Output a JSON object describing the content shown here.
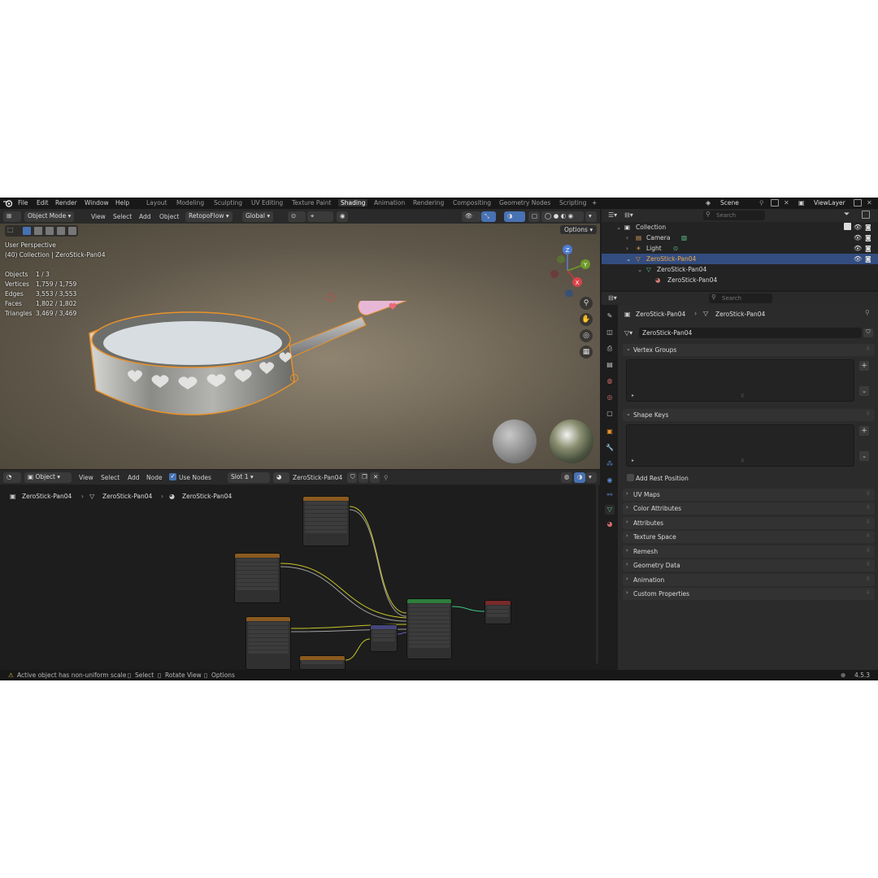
{
  "menu": {
    "file": "File",
    "edit": "Edit",
    "render": "Render",
    "window": "Window",
    "help": "Help"
  },
  "workspaces": [
    "Layout",
    "Modeling",
    "Sculpting",
    "UV Editing",
    "Texture Paint",
    "Shading",
    "Animation",
    "Rendering",
    "Compositing",
    "Geometry Nodes",
    "Scripting"
  ],
  "active_workspace": "Shading",
  "scene": {
    "name": "Scene",
    "view_layer": "ViewLayer"
  },
  "viewport_header": {
    "mode": "Object Mode",
    "view": "View",
    "select": "Select",
    "add": "Add",
    "object": "Object",
    "addon": "RetopoFlow",
    "orientation": "Global",
    "options": "Options"
  },
  "viewport": {
    "perspective": "User Perspective",
    "collection_line": "(40) Collection | ZeroStick-Pan04",
    "stats": [
      {
        "label": "Objects",
        "value": "1 / 3"
      },
      {
        "label": "Vertices",
        "value": "1,759 / 1,759"
      },
      {
        "label": "Edges",
        "value": "3,553 / 3,553"
      },
      {
        "label": "Faces",
        "value": "1,802 / 1,802"
      },
      {
        "label": "Triangles",
        "value": "3,469 / 3,469"
      }
    ],
    "gizmo": {
      "x": "X",
      "y": "Y",
      "z": "Z"
    }
  },
  "node_header": {
    "mode": "Object",
    "view": "View",
    "select": "Select",
    "add": "Add",
    "node": "Node",
    "use_nodes": "Use Nodes",
    "slot": "Slot 1",
    "material": "ZeroStick-Pan04"
  },
  "breadcrumb": [
    "ZeroStick-Pan04",
    "ZeroStick-Pan04",
    "ZeroStick-Pan04"
  ],
  "status": {
    "warning": "Active object has non-uniform scale",
    "select": "Select",
    "rotate": "Rotate View",
    "options": "Options",
    "version": "4.5.3"
  },
  "outliner": {
    "search_placeholder": "Search",
    "collection": "Collection",
    "items": [
      "Camera",
      "Light",
      "ZeroStick-Pan04",
      "ZeroStick-Pan04",
      "ZeroStick-Pan04"
    ]
  },
  "properties": {
    "search_placeholder": "Search",
    "breadcrumb": [
      "ZeroStick-Pan04",
      "ZeroStick-Pan04"
    ],
    "mesh_name": "ZeroStick-Pan04",
    "panels": {
      "vertex_groups": "Vertex Groups",
      "shape_keys": "Shape Keys",
      "add_rest_position": "Add Rest Position",
      "collapsed": [
        "UV Maps",
        "Color Attributes",
        "Attributes",
        "Texture Space",
        "Remesh",
        "Geometry Data",
        "Animation",
        "Custom Properties"
      ]
    }
  },
  "colors": {
    "selection": "#334d80",
    "outline": "#e8922a",
    "accent_blue": "#4772b3"
  }
}
